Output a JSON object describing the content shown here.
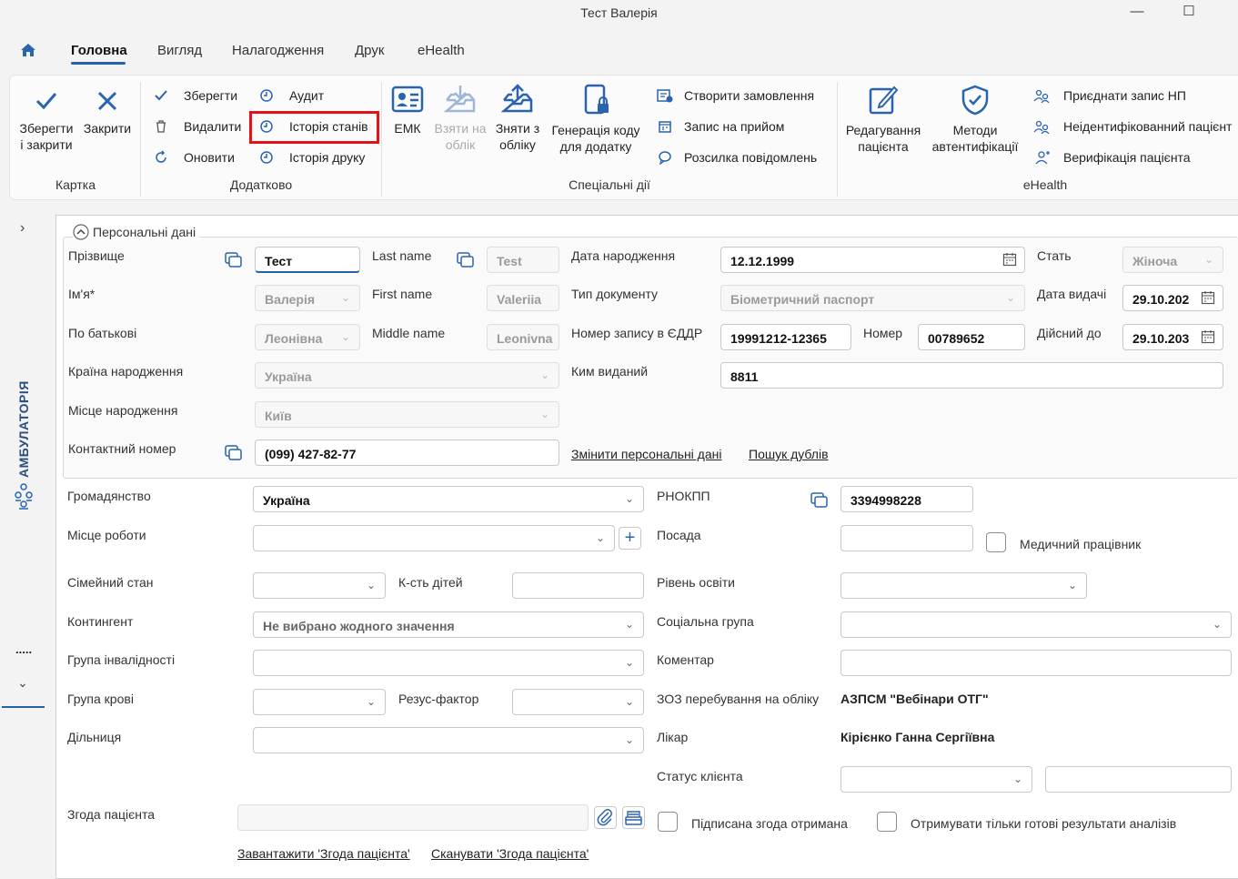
{
  "window": {
    "title": "Тест Валерія",
    "minimize": "—",
    "maximize": "☐"
  },
  "tabs": [
    "Головна",
    "Вигляд",
    "Налагодження",
    "Друк",
    "eHealth"
  ],
  "ribbon": {
    "kartka": {
      "save_close": [
        "Зберегти",
        "і закрити"
      ],
      "close": "Закрити",
      "group": "Картка"
    },
    "dodatkovo": {
      "save": "Зберегти",
      "delete": "Видалити",
      "refresh": "Оновити",
      "audit": "Аудит",
      "status_history": "Історія станів",
      "print_history": "Історія друку",
      "group": "Додатково"
    },
    "special": {
      "emk": "ЕМК",
      "take": [
        "Взяти на",
        "облік"
      ],
      "remove": [
        "Зняти з",
        "обліку"
      ],
      "gen": [
        "Генерація коду",
        "для додатку"
      ],
      "create_order": "Створити замовлення",
      "appointment": "Запис на прийом",
      "mailing": "Розсилка повідомлень",
      "group": "Спеціальні дії"
    },
    "ehealth": {
      "edit": [
        "Редагування",
        "пацієнта"
      ],
      "auth": [
        "Методи",
        "автентифікації"
      ],
      "attach": "Приєднати запис НП",
      "unidentified": "Неідентифікованний пацієнт",
      "verify": "Верифікація пацієнта",
      "group": "eHealth"
    }
  },
  "sidebar": {
    "vertical_label": "АМБУЛАТОРІЯ",
    "dots": "....."
  },
  "personal": {
    "section_title": "Персональні дані",
    "surname_label": "Прізвище",
    "surname": "Тест",
    "last_name_label": "Last name",
    "last_name": "Test",
    "dob_label": "Дата народження",
    "dob": "12.12.1999",
    "sex_label": "Стать",
    "sex": "Жіноча",
    "name_label": "Ім'я*",
    "name": "Валерія",
    "first_name_label": "First name",
    "first_name": "Valeriia",
    "doc_type_label": "Тип документу",
    "doc_type": "Біометричний паспорт",
    "issue_date_label": "Дата видачі",
    "issue_date": "29.10.202",
    "patronymic_label": "По батькові",
    "patronymic": "Леонівна",
    "middle_name_label": "Middle name",
    "middle_name": "Leonivna",
    "eddr_label": "Номер запису в ЄДДР",
    "eddr": "19991212-12365",
    "number_label": "Номер",
    "number": "00789652",
    "valid_until_label": "Дійсний до",
    "valid_until": "29.10.203",
    "birth_country_label": "Країна народження",
    "birth_country": "Україна",
    "issued_by_label": "Ким виданий",
    "issued_by": "8811",
    "birth_place_label": "Місце народження",
    "birth_place": "Київ",
    "phone_label": "Контактний номер",
    "phone": "(099) 427-82-77",
    "change_link": "Змінити персональні дані",
    "duplicates_link": "Пошук дублів"
  },
  "form": {
    "citizenship_label": "Громадянство",
    "citizenship": "Україна",
    "rnokpp_label": "РНОКПП",
    "rnokpp": "3394998228",
    "workplace_label": "Місце роботи",
    "workplace": "",
    "position_label": "Посада",
    "position": "",
    "medic_label": "Медичний працівник",
    "family_label": "Сімейний стан",
    "family": "",
    "children_label": "К-сть дітей",
    "children": "",
    "education_label": "Рівень освіти",
    "education": "",
    "contingent_label": "Контингент",
    "contingent": "Не вибрано жодного значення",
    "social_label": "Соціальна група",
    "social": "",
    "disability_label": "Група інвалідності",
    "disability": "",
    "comment_label": "Коментар",
    "comment": "",
    "blood_label": "Група крові",
    "blood": "",
    "rhesus_label": "Резус-фактор",
    "rhesus": "",
    "zoz_label": "ЗОЗ перебування на обліку",
    "zoz": "АЗПСМ \"Вебінари ОТГ\"",
    "district_label": "Дільниця",
    "district": "",
    "doctor_label": "Лікар",
    "doctor": "Кірієнко Ганна Сергіївна",
    "client_status_label": "Статус клієнта",
    "client_status": "",
    "client_status_extra": "",
    "consent_label": "Згода пацієнта",
    "consent": "",
    "signed_label": "Підписана згода отримана",
    "ready_only_label": "Отримувати тільки готові результати аналізів",
    "download_link": "Завантажити 'Згода пацієнта'",
    "scan_link": "Сканувати 'Згода пацієнта'"
  },
  "colors": {
    "accent": "#2563a8",
    "highlight": "#e0121a",
    "icon": "#2a63b0"
  }
}
